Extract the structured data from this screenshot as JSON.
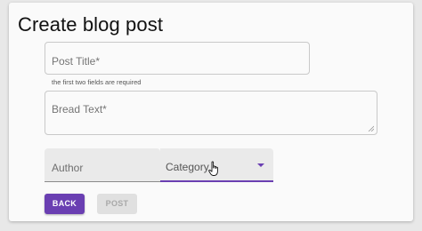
{
  "page": {
    "title": "Create blog post"
  },
  "form": {
    "post_title_placeholder": "Post Title*",
    "helper_text": "the first two fields are required",
    "bread_text_placeholder": "Bread Text*",
    "author_label": "Author",
    "category_label": "Category"
  },
  "actions": {
    "back_label": "BACK",
    "post_label": "POST",
    "post_disabled": true
  },
  "colors": {
    "accent": "#6a3fb2"
  },
  "icons": {
    "dropdown": "chevron-down-icon",
    "cursor": "hand-pointer-icon",
    "resize": "resize-handle-icon"
  }
}
